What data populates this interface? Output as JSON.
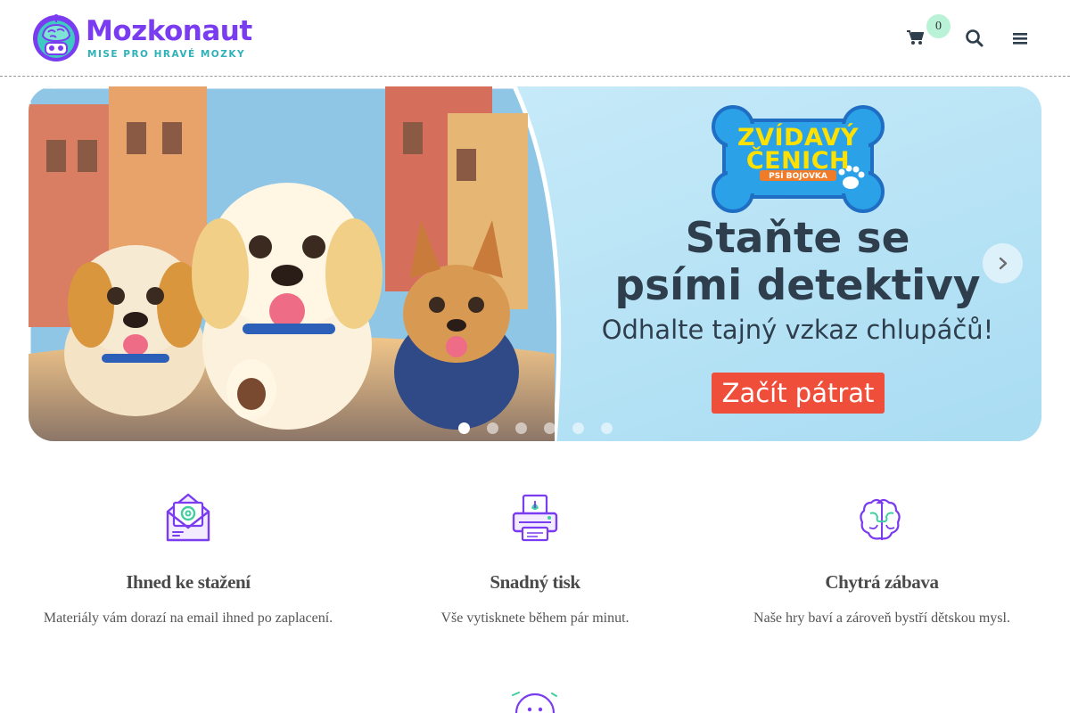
{
  "header": {
    "logo": {
      "name": "Mozkonaut",
      "tagline": "MISE PRO HRAVÉ MOZKY",
      "icon": "brain-robot-logo-icon"
    },
    "cart": {
      "icon": "cart-icon",
      "count": "0"
    },
    "search": {
      "icon": "search-icon"
    },
    "menu": {
      "icon": "hamburger-menu-icon"
    }
  },
  "hero": {
    "badge": {
      "title": "ZVÍDAVÝ ČENICH",
      "subtitle": "PSÍ BOJOVKA",
      "icon": "paw-icon"
    },
    "headline_line1": "Staňte se",
    "headline_line2": "psími detektivy",
    "subheadline": "Odhalte tajný vzkaz chlupáčů!",
    "cta_label": "Začít pátrat",
    "next_icon": "chevron-right-icon",
    "slides_count": 6,
    "active_slide": 1,
    "colors": {
      "sky": "#bde3f3",
      "cta": "#ef4e3a",
      "headline": "#2e3e4c",
      "badge": "#2ba1e8"
    }
  },
  "features": [
    {
      "icon": "email-download-icon",
      "title": "Ihned ke stažení",
      "text": "Materiály vám dorazí na email ihned po zaplacení."
    },
    {
      "icon": "printer-icon",
      "title": "Snadný tisk",
      "text": "Vše vytisknete během pár minut."
    },
    {
      "icon": "brain-puzzle-icon",
      "title": "Chytrá zábava",
      "text": "Naše hry baví a zároveň bystří dětskou mysl."
    }
  ],
  "colors": {
    "primary": "#7a3cf0",
    "accent": "#2fb2b7",
    "badge_bg": "#b9f2d6"
  }
}
